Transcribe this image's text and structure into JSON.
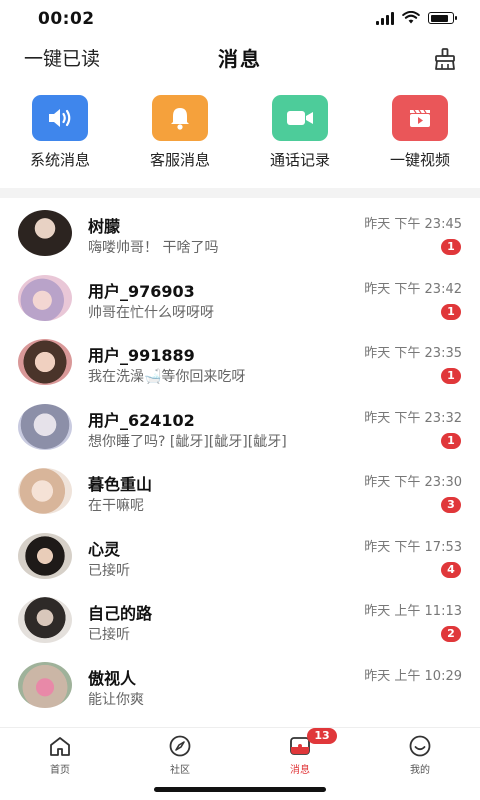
{
  "status": {
    "time": "00:02"
  },
  "header": {
    "read_all": "一键已读",
    "title": "消息",
    "clean_icon": "broom-icon"
  },
  "quick_actions": [
    {
      "label": "系统消息",
      "icon": "speaker-icon",
      "color": "#3f86ec"
    },
    {
      "label": "客服消息",
      "icon": "bell-icon",
      "color": "#f5a13c"
    },
    {
      "label": "通话记录",
      "icon": "video-camera-icon",
      "color": "#4dcc9a"
    },
    {
      "label": "一键视频",
      "icon": "clapperboard-icon",
      "color": "#ea5659"
    }
  ],
  "messages": [
    {
      "name": "树朦",
      "preview": "嗨喽帅哥！ 干啥了吗",
      "time": "昨天 下午 23:45",
      "badge": "1"
    },
    {
      "name": "用户_976903",
      "preview": "帅哥在忙什么呀呀呀",
      "time": "昨天 下午 23:42",
      "badge": "1"
    },
    {
      "name": "用户_991889",
      "preview": "我在洗澡🛁等你回来吃呀",
      "time": "昨天 下午 23:35",
      "badge": "1"
    },
    {
      "name": "用户_624102",
      "preview": "想你睡了吗? [龇牙][龇牙][龇牙]",
      "time": "昨天 下午 23:32",
      "badge": "1"
    },
    {
      "name": "暮色重山",
      "preview": "在干嘛呢",
      "time": "昨天 下午 23:30",
      "badge": "3"
    },
    {
      "name": "心灵",
      "preview": "已接听",
      "time": "昨天 下午 17:53",
      "badge": "4"
    },
    {
      "name": "自己的路",
      "preview": "已接听",
      "time": "昨天 上午 11:13",
      "badge": "2"
    },
    {
      "name": "傲视人",
      "preview": "能让你爽",
      "time": "昨天 上午 10:29",
      "badge": ""
    }
  ],
  "tabs": [
    {
      "label": "首页",
      "icon": "home-icon"
    },
    {
      "label": "社区",
      "icon": "compass-icon"
    },
    {
      "label": "消息",
      "icon": "message-icon",
      "badge": "13",
      "active": true
    },
    {
      "label": "我的",
      "icon": "smile-icon"
    }
  ],
  "colors": {
    "accent": "#e0373a"
  }
}
